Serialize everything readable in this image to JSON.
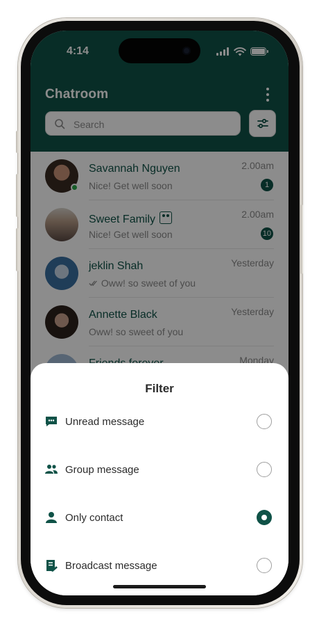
{
  "status_bar": {
    "time": "4:14"
  },
  "app": {
    "title": "Chatroom"
  },
  "search": {
    "placeholder": "Search"
  },
  "chats": [
    {
      "name": "Savannah Nguyen",
      "message": "Nice! Get well soon",
      "time": "2.00am",
      "unread": "1",
      "online": true
    },
    {
      "name": "Sweet Family",
      "message": "Nice! Get well soon",
      "time": "2.00am",
      "unread": "10",
      "group": true
    },
    {
      "name": "jeklin Shah",
      "message": "Oww! so sweet of you",
      "time": "Yesterday",
      "read_receipt": true
    },
    {
      "name": "Annette Black",
      "message": "Oww! so sweet of you",
      "time": "Yesterday"
    },
    {
      "name": "Friends forever",
      "message": "",
      "time": "Monday"
    }
  ],
  "filter_sheet": {
    "title": "Filter",
    "options": [
      {
        "label": "Unread message",
        "icon": "chat-bubble-icon",
        "selected": false
      },
      {
        "label": "Group message",
        "icon": "group-icon",
        "selected": false
      },
      {
        "label": "Only contact",
        "icon": "person-icon",
        "selected": true
      },
      {
        "label": "Broadcast message",
        "icon": "broadcast-icon",
        "selected": false
      }
    ]
  },
  "colors": {
    "primary": "#0f5247",
    "online": "#2aa84a",
    "overlay": "rgba(0,0,0,0.45)"
  }
}
